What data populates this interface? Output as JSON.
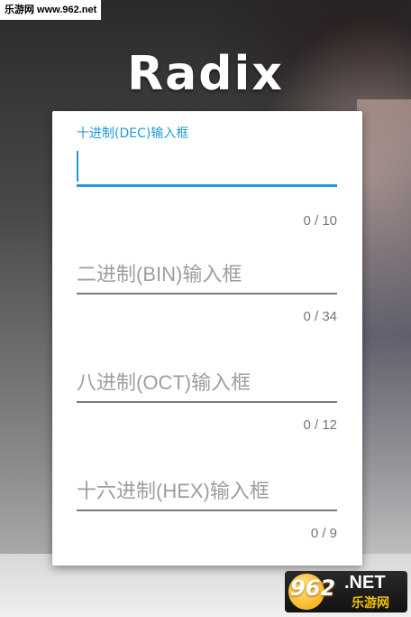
{
  "watermark": "乐游网 www.962.net",
  "app_title": "Radix",
  "fields": [
    {
      "label": "十进制(DEC)输入框",
      "value": "",
      "counter": "0 / 10"
    },
    {
      "placeholder": "二进制(BIN)输入框",
      "counter": "0 / 34"
    },
    {
      "placeholder": "八进制(OCT)输入框",
      "counter": "0 / 12"
    },
    {
      "placeholder": "十六进制(HEX)输入框",
      "counter": "0 / 9"
    }
  ],
  "logo": {
    "num": "962",
    "net": ".NET",
    "cn": "乐游网"
  },
  "colors": {
    "accent": "#1e9bd7",
    "card": "#ffffff"
  }
}
